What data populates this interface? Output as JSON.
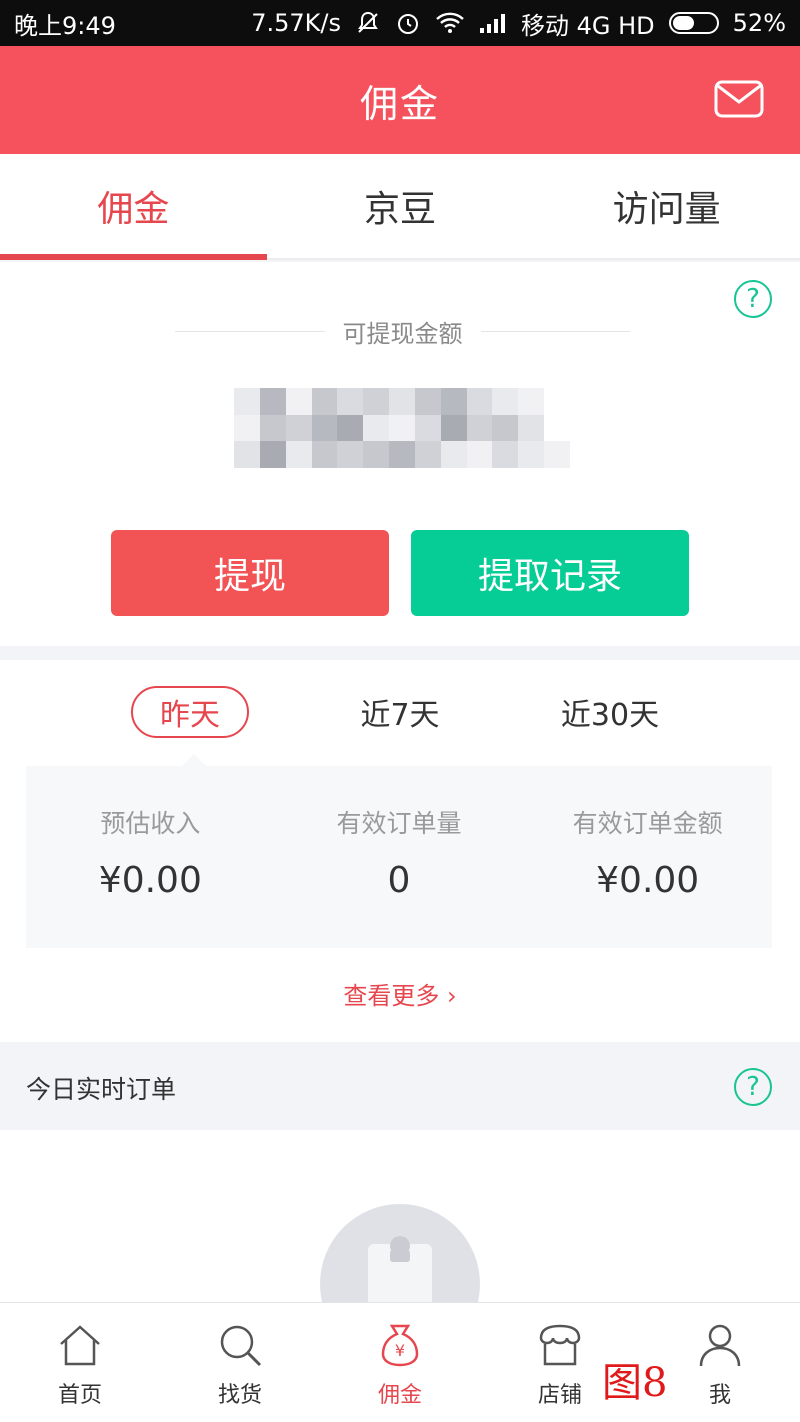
{
  "status_bar": {
    "time": "晚上9:49",
    "speed": "7.57K/s",
    "carrier": "移动 4G HD",
    "battery": "52%",
    "battery_level": 0.52
  },
  "header": {
    "title": "佣金",
    "mail_icon": "mail-icon"
  },
  "tabs": [
    {
      "label": "佣金",
      "active": true
    },
    {
      "label": "京豆",
      "active": false
    },
    {
      "label": "访问量",
      "active": false
    }
  ],
  "balance": {
    "label": "可提现金额",
    "help_icon": "question-icon",
    "withdraw_button": "提现",
    "records_button": "提取记录"
  },
  "periods": [
    {
      "label": "昨天",
      "active": true
    },
    {
      "label": "近7天",
      "active": false
    },
    {
      "label": "近30天",
      "active": false
    }
  ],
  "metrics": [
    {
      "label": "预估收入",
      "value": "¥0.00"
    },
    {
      "label": "有效订单量",
      "value": "0"
    },
    {
      "label": "有效订单金额",
      "value": "¥0.00"
    }
  ],
  "more_link": "查看更多 ›",
  "realtime": {
    "title": "今日实时订单",
    "help_icon": "question-icon"
  },
  "bottom_nav": [
    {
      "label": "首页",
      "icon": "home-icon",
      "active": false
    },
    {
      "label": "找货",
      "icon": "search-icon",
      "active": false
    },
    {
      "label": "佣金",
      "icon": "money-bag-icon",
      "active": true
    },
    {
      "label": "店铺",
      "icon": "store-icon",
      "active": false
    },
    {
      "label": "我",
      "icon": "user-icon",
      "active": false
    }
  ],
  "overlay_label": "图8",
  "colors": {
    "brand_red": "#f5525e",
    "accent_red": "#e6474e",
    "green": "#06cc96",
    "help_green": "#19c494"
  }
}
